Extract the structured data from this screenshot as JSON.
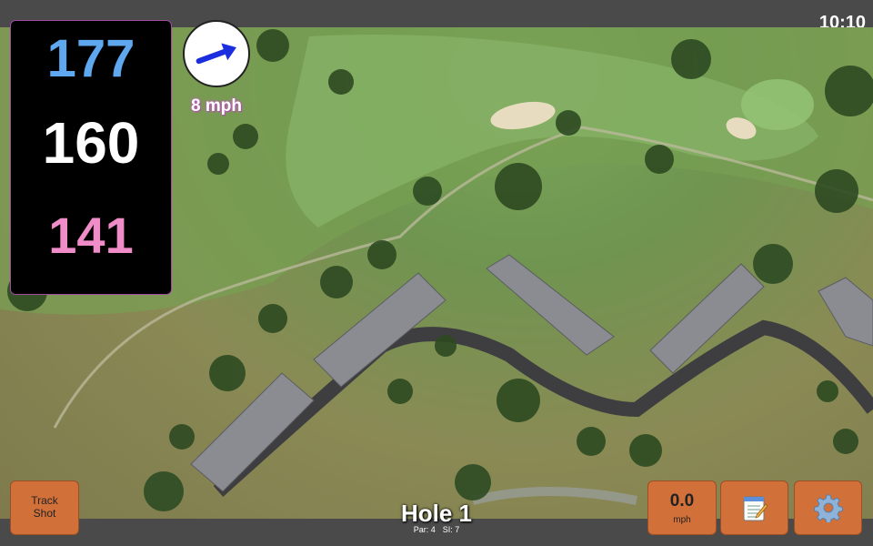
{
  "status": {
    "time": "10:10"
  },
  "yardages": {
    "back": "177",
    "center": "160",
    "front": "141"
  },
  "wind": {
    "speed_label": "8 mph",
    "arrow_icon": "arrow-right-icon"
  },
  "buttons": {
    "track_shot_line1": "Track",
    "track_shot_line2": "Shot",
    "wind_value": "0.0",
    "wind_unit": "mph",
    "notes_icon": "notepad-icon",
    "settings_icon": "gear-icon"
  },
  "hole": {
    "title": "Hole 1",
    "par": "Par: 4",
    "si": "SI: 7"
  },
  "colors": {
    "back_yardage": "#5fa8f0",
    "center_yardage": "#ffffff",
    "front_yardage": "#f08cc8",
    "button": "#d2703a"
  }
}
